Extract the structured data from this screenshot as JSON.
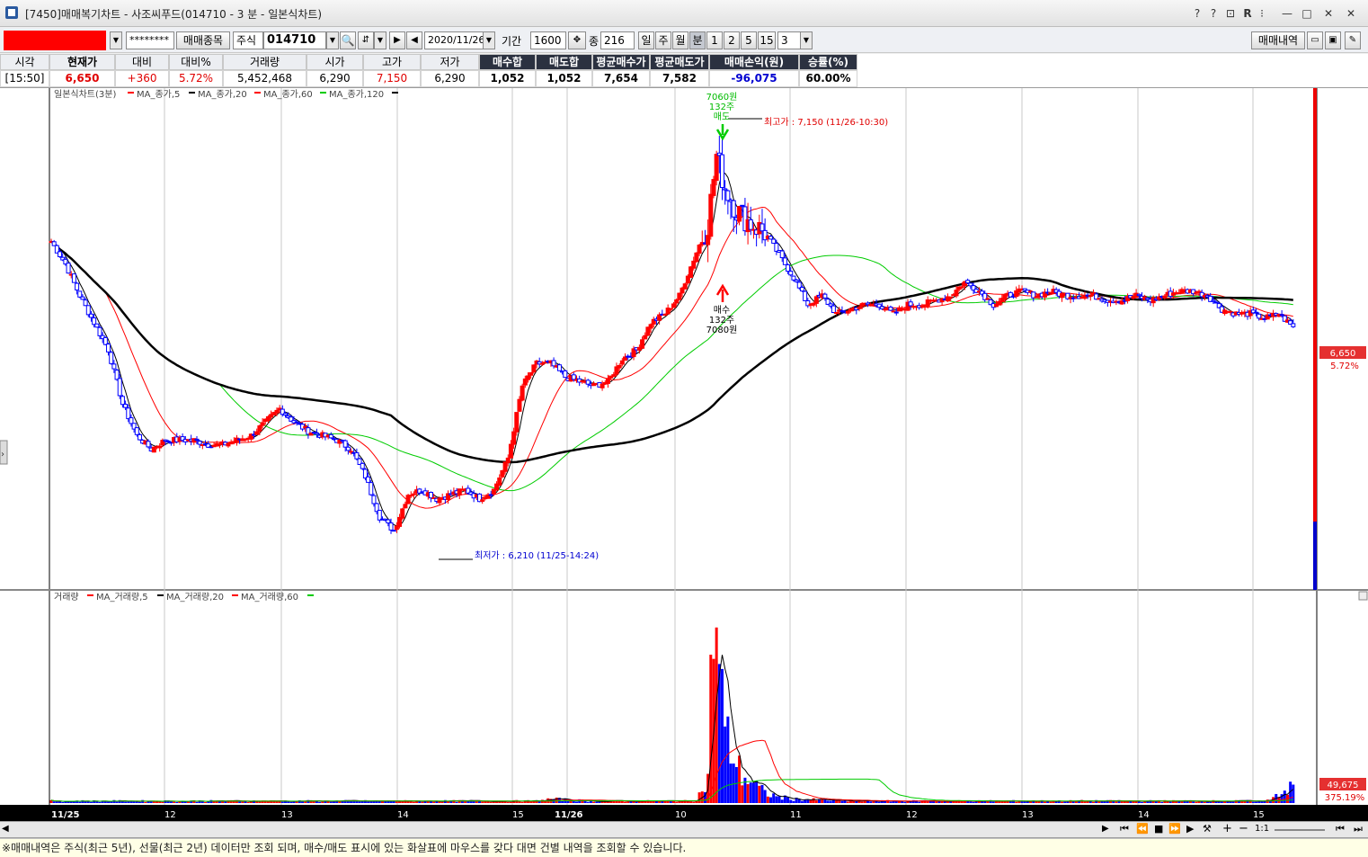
{
  "window": {
    "title": "[7450]매매복기차트 - 사조씨푸드(014710 - 3 분 - 일본식차트)",
    "controls": [
      "?",
      "?",
      "⊡",
      "R",
      "⁝",
      "—",
      "□",
      "✕"
    ]
  },
  "toolbar": {
    "masked_field": "********",
    "trade_items_label": "매매종목",
    "stock_type": "주식",
    "code": "014710",
    "date": "2020/11/26",
    "period_label": "기간",
    "period_value": "1600",
    "count_label": "종",
    "count_value": "216",
    "tabs": [
      "일",
      "주",
      "월",
      "분",
      "1",
      "2",
      "5",
      "15"
    ],
    "interval_value": "3",
    "trade_history_label": "매매내역"
  },
  "info": {
    "headers": [
      "시각",
      "현재가",
      "대비",
      "대비%",
      "거래량",
      "시가",
      "고가",
      "저가",
      "매수합",
      "매도합",
      "평균매수가",
      "평균매도가",
      "매매손익(원)",
      "승률(%)"
    ],
    "values": [
      "[15:50]",
      "6,650",
      "+360",
      "5.72%",
      "5,452,468",
      "6,290",
      "7,150",
      "6,290",
      "1,052",
      "1,052",
      "7,654",
      "7,582",
      "-96,075",
      "60.00%"
    ]
  },
  "chart": {
    "price_legend": {
      "title": "일본식차트(3분)",
      "items": [
        {
          "label": "MA_종가,5",
          "color": "#000000"
        },
        {
          "label": "MA_종가,20",
          "color": "#ff0000"
        },
        {
          "label": "MA_종가,60",
          "color": "#00cc00"
        },
        {
          "label": "MA_종가,120",
          "color": "#000000"
        }
      ]
    },
    "volume_legend": {
      "title": "거래량",
      "items": [
        {
          "label": "MA_거래량,5",
          "color": "#000000"
        },
        {
          "label": "MA_거래량,20",
          "color": "#ff0000"
        },
        {
          "label": "MA_거래량,60",
          "color": "#00cc00"
        }
      ]
    },
    "annotations": {
      "high": "최고가 : 7,150 (11/26-10:30)",
      "low": "최저가 : 6,210 (11/25-14:24)",
      "sell_lines": [
        "7060원",
        "132주",
        "매도"
      ],
      "buy_lines": [
        "매수",
        "132주",
        "7080원"
      ]
    },
    "price_tag": "6,650",
    "price_tag_pct": "5.72%",
    "volume_tag": "49,675",
    "volume_tag_pct": "375.19%",
    "x_labels": [
      "11/25",
      "12",
      "13",
      "14",
      "15",
      "11/26",
      "10",
      "11",
      "12",
      "13",
      "14",
      "15"
    ],
    "colors": {
      "up": "#ff0000",
      "down": "#0000ff",
      "ma_green": "#00cc00"
    }
  },
  "chart_data": {
    "type": "candlestick",
    "title": "일본식차트(3분)",
    "high": {
      "value": 7150,
      "time": "11/26-10:30"
    },
    "low": {
      "value": 6210,
      "time": "11/25-14:24"
    },
    "close": 6650,
    "anchors_price": [
      [
        0,
        6880
      ],
      [
        5,
        6830
      ],
      [
        10,
        6760
      ],
      [
        15,
        6700
      ],
      [
        20,
        6640
      ],
      [
        25,
        6520
      ],
      [
        30,
        6450
      ],
      [
        35,
        6420
      ],
      [
        40,
        6440
      ],
      [
        45,
        6440
      ],
      [
        50,
        6440
      ],
      [
        55,
        6430
      ],
      [
        60,
        6430
      ],
      [
        65,
        6440
      ],
      [
        70,
        6450
      ],
      [
        75,
        6480
      ],
      [
        80,
        6510
      ],
      [
        85,
        6480
      ],
      [
        90,
        6460
      ],
      [
        95,
        6450
      ],
      [
        100,
        6440
      ],
      [
        105,
        6420
      ],
      [
        110,
        6360
      ],
      [
        115,
        6270
      ],
      [
        120,
        6240
      ],
      [
        125,
        6320
      ],
      [
        130,
        6330
      ],
      [
        135,
        6310
      ],
      [
        140,
        6320
      ],
      [
        145,
        6330
      ],
      [
        150,
        6310
      ],
      [
        155,
        6330
      ],
      [
        160,
        6400
      ],
      [
        165,
        6560
      ],
      [
        170,
        6610
      ],
      [
        175,
        6610
      ],
      [
        180,
        6580
      ],
      [
        185,
        6570
      ],
      [
        190,
        6560
      ],
      [
        195,
        6570
      ],
      [
        200,
        6620
      ],
      [
        205,
        6640
      ],
      [
        210,
        6700
      ],
      [
        215,
        6720
      ],
      [
        220,
        6760
      ],
      [
        225,
        6840
      ],
      [
        230,
        6920
      ],
      [
        233,
        7070
      ],
      [
        236,
        7000
      ],
      [
        240,
        6950
      ],
      [
        245,
        6920
      ],
      [
        250,
        6900
      ],
      [
        255,
        6850
      ],
      [
        260,
        6800
      ],
      [
        265,
        6740
      ],
      [
        270,
        6760
      ],
      [
        275,
        6720
      ],
      [
        280,
        6730
      ],
      [
        285,
        6740
      ],
      [
        290,
        6740
      ],
      [
        295,
        6720
      ],
      [
        300,
        6740
      ],
      [
        305,
        6740
      ],
      [
        310,
        6750
      ],
      [
        315,
        6760
      ],
      [
        320,
        6790
      ],
      [
        325,
        6770
      ],
      [
        330,
        6740
      ],
      [
        335,
        6760
      ],
      [
        340,
        6770
      ],
      [
        345,
        6760
      ],
      [
        350,
        6770
      ],
      [
        355,
        6760
      ],
      [
        360,
        6760
      ],
      [
        365,
        6760
      ],
      [
        370,
        6750
      ],
      [
        375,
        6750
      ],
      [
        380,
        6760
      ],
      [
        385,
        6750
      ],
      [
        390,
        6760
      ],
      [
        395,
        6770
      ],
      [
        400,
        6770
      ],
      [
        405,
        6760
      ],
      [
        410,
        6730
      ],
      [
        415,
        6720
      ],
      [
        420,
        6720
      ],
      [
        425,
        6710
      ],
      [
        430,
        6720
      ],
      [
        435,
        6690
      ]
    ],
    "anchors_volume": [
      [
        0,
        0.01
      ],
      [
        170,
        0.01
      ],
      [
        175,
        0.02
      ],
      [
        190,
        0.01
      ],
      [
        225,
        0.01
      ],
      [
        228,
        0.06
      ],
      [
        230,
        0.12
      ],
      [
        232,
        1.0
      ],
      [
        234,
        0.7
      ],
      [
        236,
        0.35
      ],
      [
        238,
        0.28
      ],
      [
        240,
        0.2
      ],
      [
        242,
        0.14
      ],
      [
        244,
        0.12
      ],
      [
        246,
        0.1
      ],
      [
        250,
        0.05
      ],
      [
        255,
        0.03
      ],
      [
        260,
        0.02
      ],
      [
        280,
        0.01
      ],
      [
        425,
        0.01
      ],
      [
        430,
        0.05
      ],
      [
        435,
        0.08
      ]
    ]
  }
}
